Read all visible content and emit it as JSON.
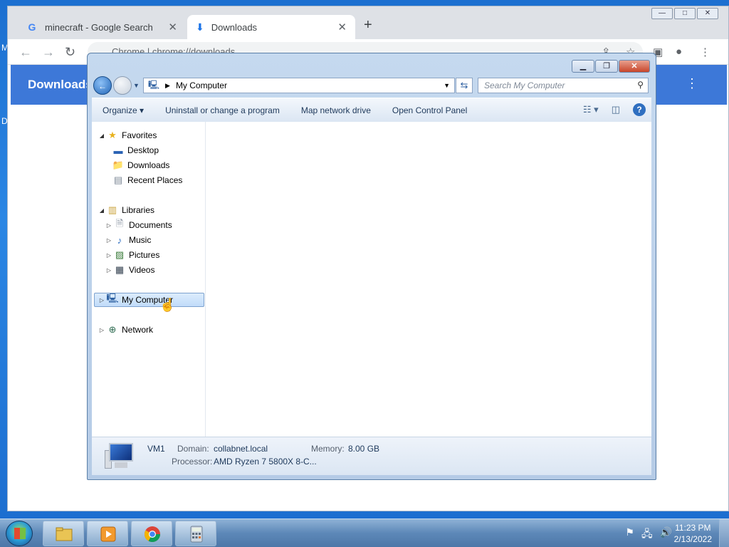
{
  "desktop": {
    "edge_labels": [
      "M",
      "D"
    ]
  },
  "chrome": {
    "tabs": [
      {
        "title": "minecraft - Google Search",
        "close": "✕"
      },
      {
        "title": "Downloads",
        "close": "✕"
      }
    ],
    "new_tab": "+",
    "omnibox_text": "Chrome  |  chrome://downloads",
    "page_title": "Downloads",
    "page_menu": "⋮"
  },
  "explorer": {
    "address": "My Computer",
    "search_placeholder": "Search My Computer",
    "commands": [
      "Organize ▾",
      "Uninstall or change a program",
      "Map network drive",
      "Open Control Panel"
    ],
    "help": "?",
    "tree": {
      "favorites": "Favorites",
      "desktop": "Desktop",
      "downloads": "Downloads",
      "recent": "Recent Places",
      "libraries": "Libraries",
      "documents": "Documents",
      "music": "Music",
      "pictures": "Pictures",
      "videos": "Videos",
      "my_computer": "My Computer",
      "network": "Network"
    },
    "status": {
      "name": "VM1",
      "domain_label": "Domain:",
      "domain_value": "collabnet.local",
      "memory_label": "Memory:",
      "memory_value": "8.00 GB",
      "processor_label": "Processor:",
      "processor_value": "AMD Ryzen 7 5800X 8-C..."
    }
  },
  "taskbar": {
    "time": "11:23 PM",
    "date": "2/13/2022"
  },
  "colors": {
    "desktop": "#1c6fd0",
    "chrome_header": "#3d78d8",
    "selection": "#c1dcfa"
  }
}
